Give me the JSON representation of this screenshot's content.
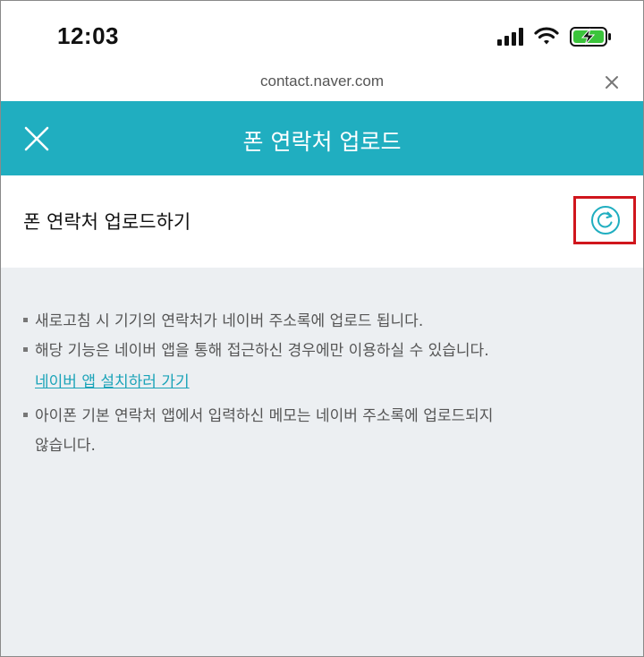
{
  "status_bar": {
    "time": "12:03"
  },
  "browser": {
    "url": "contact.naver.com"
  },
  "header": {
    "title": "폰 연락처 업로드",
    "accent_color": "#20aec0"
  },
  "upload": {
    "label": "폰 연락처 업로드하기",
    "highlight_color": "#d0161d"
  },
  "info": {
    "notes": [
      "새로고침 시 기기의 연락처가 네이버 주소록에 업로드 됩니다.",
      "해당 기능은 네이버 앱을 통해 접근하신 경우에만 이용하실 수 있습니다.",
      "아이폰 기본 연락처 앱에서 입력하신 메모는 네이버 주소록에 업로드되지"
    ],
    "note_3_continued": "않습니다.",
    "install_link": "네이버 앱 설치하러 가기"
  },
  "icons": {
    "signal": "cellular-signal-icon",
    "wifi": "wifi-icon",
    "battery": "battery-charging-icon",
    "url_close": "close-icon",
    "header_close": "close-icon",
    "refresh": "refresh-icon"
  }
}
